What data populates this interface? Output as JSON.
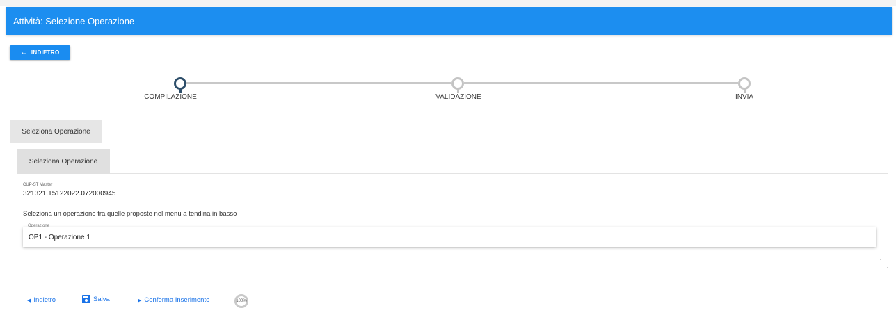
{
  "header": {
    "title": "Attività: Selezione Operazione"
  },
  "toolbar": {
    "back_label": "INDIETRO",
    "back_icon": "arrow-left-icon"
  },
  "stepper": {
    "steps": [
      {
        "label": "COMPILAZIONE",
        "active": true
      },
      {
        "label": "VALIDAZIONE",
        "active": false
      },
      {
        "label": "INVIA",
        "active": false
      }
    ]
  },
  "tabs": {
    "outer": "Seleziona Operazione",
    "inner": "Seleziona Operazione"
  },
  "form": {
    "cup_label": "CUP-ST Master",
    "cup_value": "321321.15122022.072000945",
    "instruction": "Seleziona un operazione tra quelle proposte nel menu a tendina in basso",
    "operation_label": "Operazione",
    "operation_selected": "OP1 - Operazione 1"
  },
  "footer": {
    "back_label": "Indietro",
    "save_label": "Salva",
    "confirm_label": "Conferma Inserimento",
    "progress_text": "100%",
    "progress_value": 100
  },
  "colors": {
    "header_bg": "#1c8ef0",
    "button_bg": "#1a8cf0",
    "step_active": "#2d4e6a",
    "step_inactive": "#c4c4c4",
    "link": "#1a73e8"
  }
}
